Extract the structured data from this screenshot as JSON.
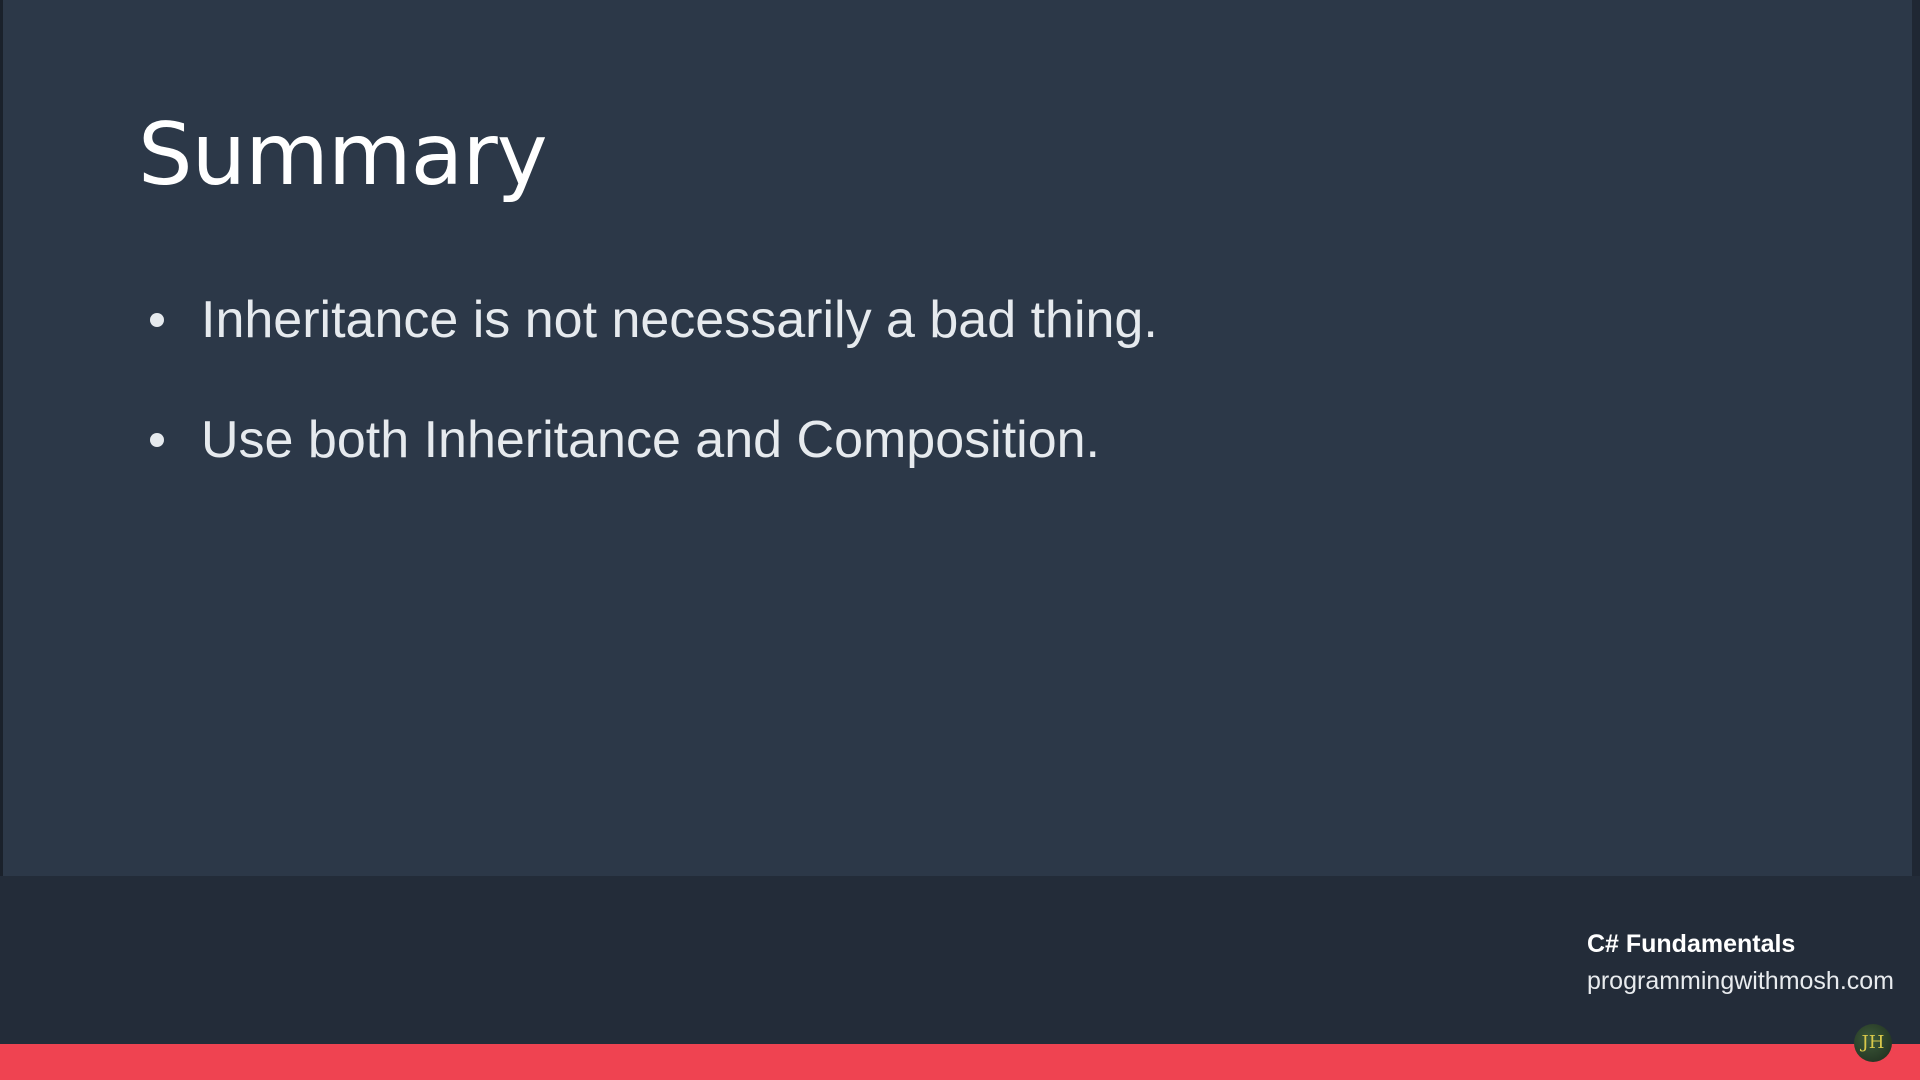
{
  "slide": {
    "title": "Summary",
    "bullets": [
      "Inheritance is not necessarily a bad thing.",
      "Use both Inheritance and Composition."
    ]
  },
  "footer": {
    "course_name": "C# Fundamentals",
    "site_url": "programmingwithmosh.com"
  },
  "watermark": {
    "initials": "JH"
  },
  "colors": {
    "background": "#2c3848",
    "footer_background": "#232c39",
    "accent_bar": "#ef4351",
    "text": "#ffffff"
  }
}
